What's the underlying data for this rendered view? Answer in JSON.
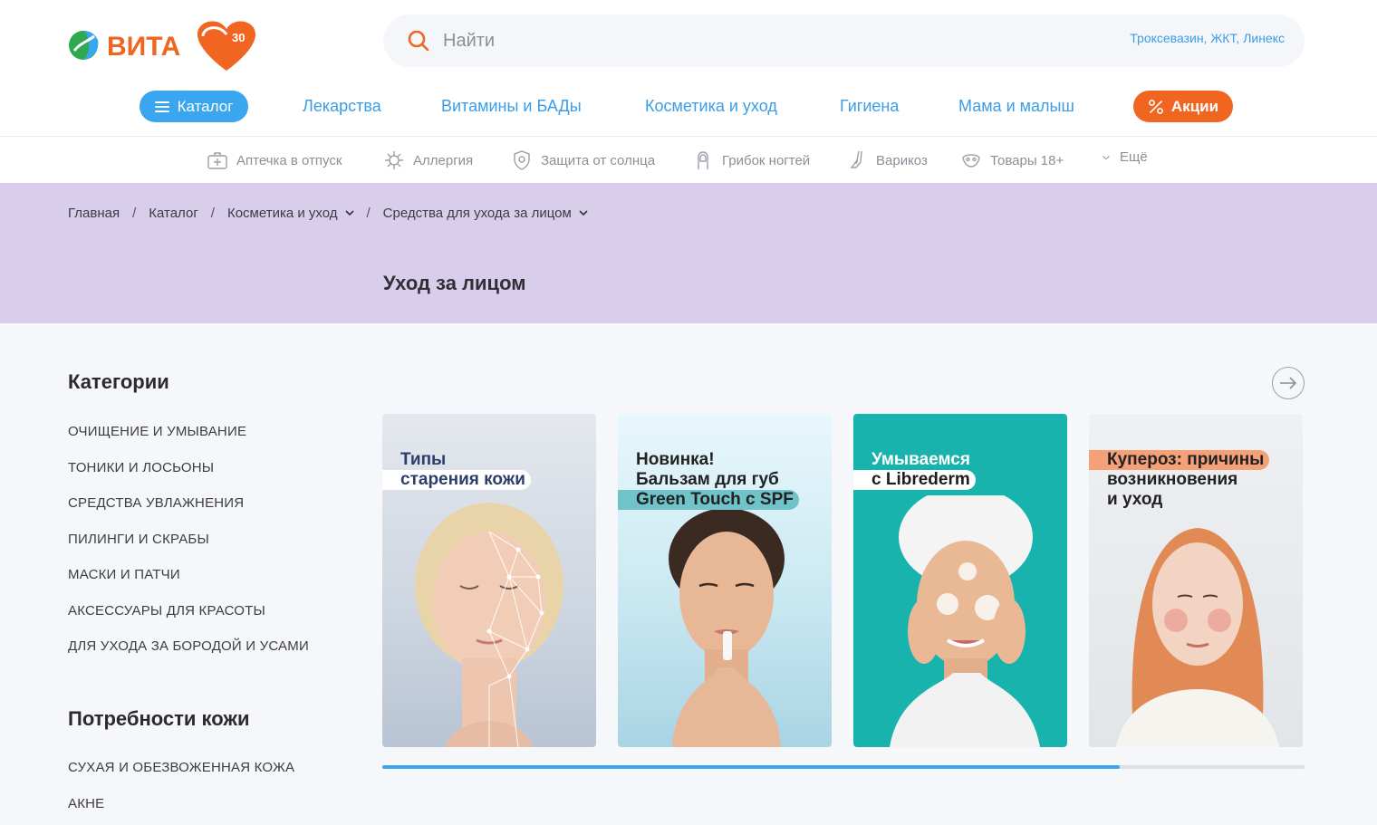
{
  "header": {
    "logo_text": "ВИТА",
    "logo_badge": "30",
    "search": {
      "placeholder": "Найти",
      "hint": "Троксевазин, ЖКТ, Линекс"
    },
    "catalog_label": "Каталог",
    "nav": [
      "Лекарства",
      "Витамины и БАДы",
      "Косметика и уход",
      "Гигиена",
      "Мама и малыш"
    ],
    "promo_label": "Акции"
  },
  "subnav": {
    "items": [
      "Аптечка в отпуск",
      "Аллергия",
      "Защита от солнца",
      "Грибок ногтей",
      "Варикоз",
      "Товары 18+"
    ],
    "more_label": "Ещё"
  },
  "breadcrumb": {
    "items": [
      "Главная",
      "Каталог",
      "Косметика и уход",
      "Средства для ухода за лицом"
    ],
    "separator": "/"
  },
  "page_title": "Уход за лицом",
  "sidebar": {
    "categories_heading": "Категории",
    "categories": [
      "ОЧИЩЕНИЕ И УМЫВАНИЕ",
      "ТОНИКИ И ЛОСЬОНЫ",
      "СРЕДСТВА УВЛАЖНЕНИЯ",
      "ПИЛИНГИ И СКРАБЫ",
      "МАСКИ И ПАТЧИ",
      "АКСЕССУАРЫ ДЛЯ КРАСОТЫ",
      "ДЛЯ УХОДА ЗА БОРОДОЙ И УСАМИ"
    ],
    "skin_needs_heading": "Потребности кожи",
    "skin_needs": [
      "СУХАЯ И ОБЕЗВОЖЕННАЯ КОЖА",
      "АКНЕ"
    ]
  },
  "cards": [
    {
      "lines": [
        "Типы",
        "старения кожи"
      ]
    },
    {
      "lines": [
        "Новинка!",
        "Бальзам для губ",
        "Green Touch с SPF"
      ]
    },
    {
      "lines": [
        "Умываемся",
        "с Librederm"
      ]
    },
    {
      "lines": [
        "Купероз: причины",
        "возникновения",
        "и уход"
      ]
    }
  ],
  "carousel_progress": 0.8,
  "colors": {
    "brand_blue": "#3aa6f0",
    "brand_orange": "#f06520",
    "banner_bg": "#d8cdea"
  }
}
